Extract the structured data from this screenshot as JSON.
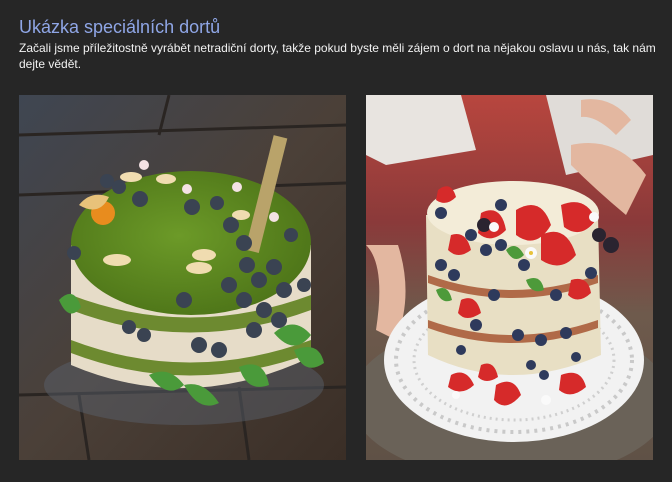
{
  "page": {
    "title": "Ukázka speciálních dortů",
    "description": "Začali jsme příležitostně vyrábět netradiční dorty, takže pokud byste měli zájem o dort na nějakou oslavu u nás, tak nám dejte vědět."
  },
  "colors": {
    "background": "#262626",
    "title": "#8fa6e6",
    "text": "#f2f2f2"
  },
  "gallery": {
    "images": [
      {
        "name": "spinach-cake-photo"
      },
      {
        "name": "berry-naked-cake-photo"
      }
    ]
  }
}
